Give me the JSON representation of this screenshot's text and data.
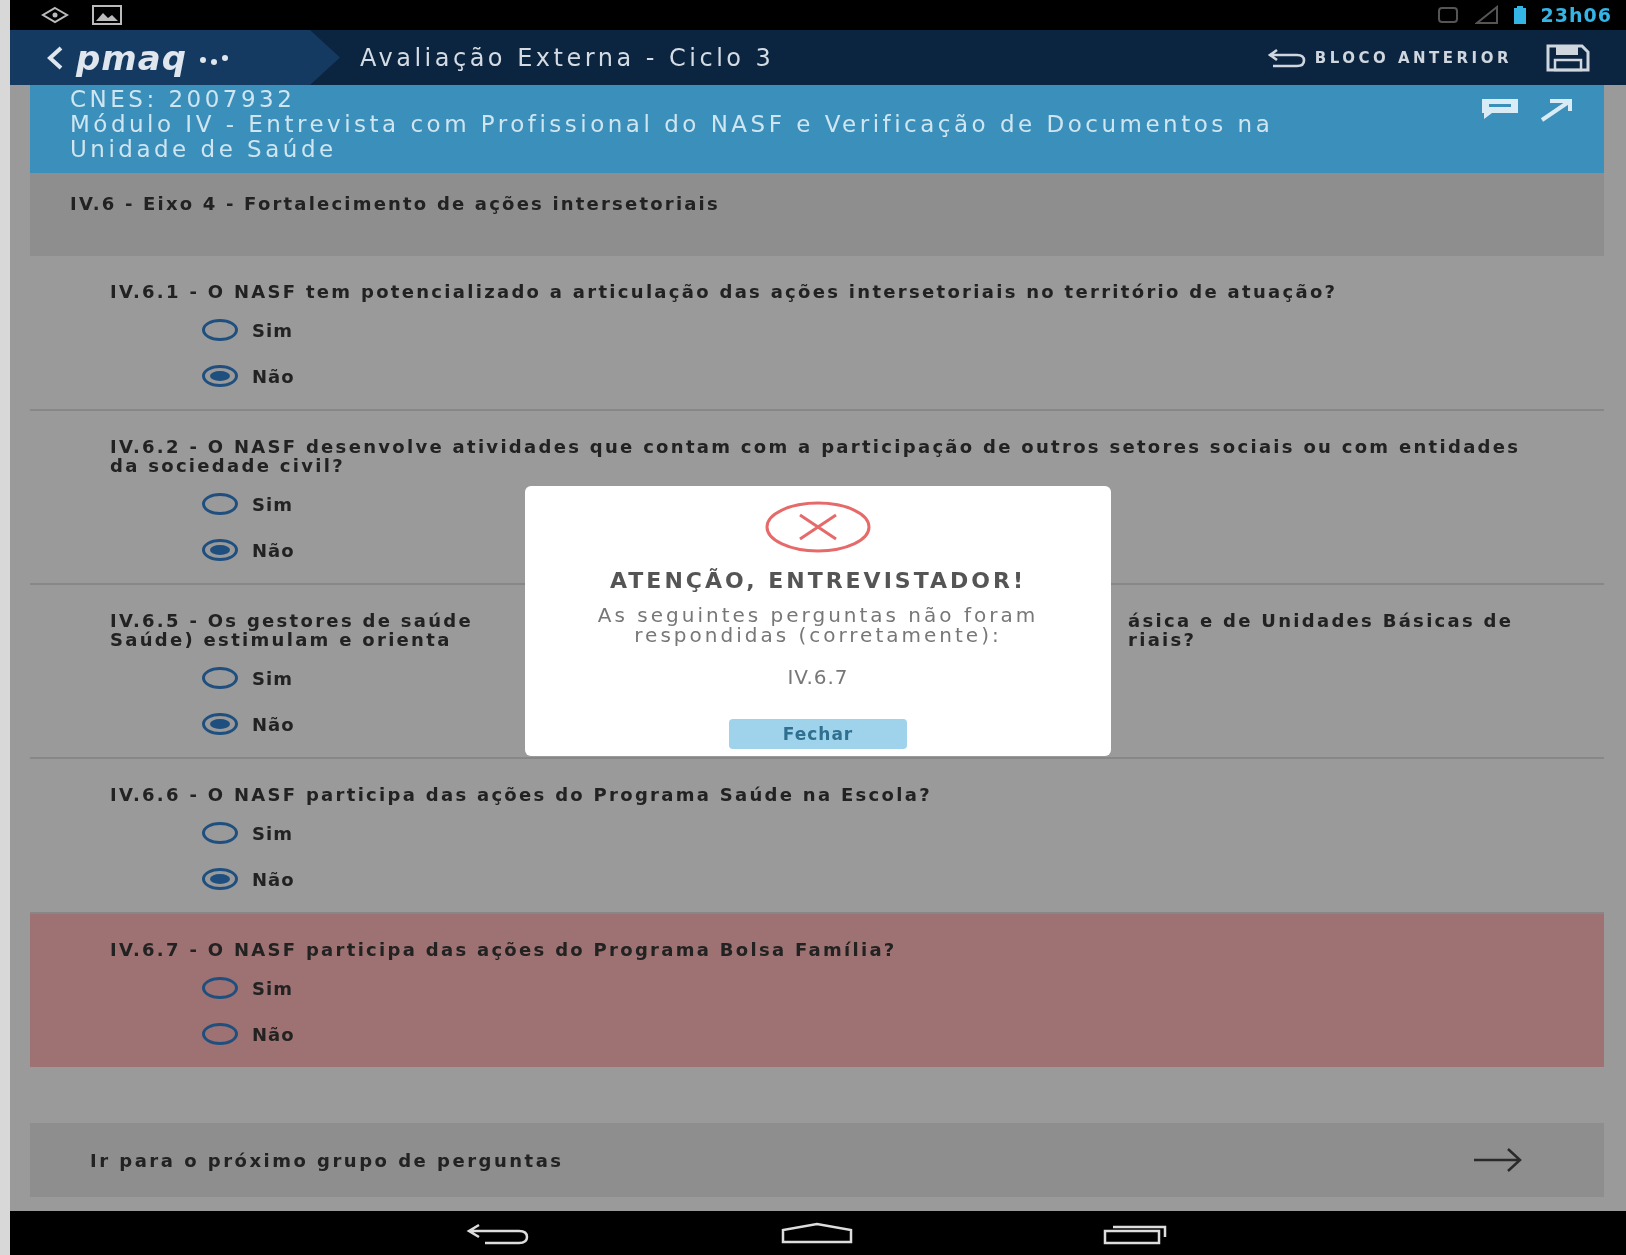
{
  "status_bar": {
    "time": "23h06"
  },
  "app_bar": {
    "logo": "pmaq",
    "title": "Avaliação Externa - Ciclo 3",
    "back_action": "BLOCO ANTERIOR"
  },
  "module": {
    "cnes": "CNES: 2007932",
    "title": "Módulo IV - Entrevista com Profissional do NASF e Verificação de Documentos na Unidade de Saúde"
  },
  "section": {
    "title": "IV.6 - Eixo 4 - Fortalecimento de ações intersetoriais"
  },
  "questions": [
    {
      "kind": "full",
      "error": false,
      "text": "IV.6.1 - O NASF tem potencializado a articulação das ações intersetoriais no território de atuação?",
      "options": [
        {
          "label": "Sim",
          "selected": false
        },
        {
          "label": "Não",
          "selected": true
        }
      ]
    },
    {
      "kind": "full",
      "error": false,
      "text": "IV.6.2 - O NASF desenvolve atividades que contam com a participação de outros setores sociais ou com entidades da sociedade civil?",
      "options": [
        {
          "label": "Sim",
          "selected": false
        },
        {
          "label": "Não",
          "selected": true
        }
      ]
    },
    {
      "kind": "split",
      "error": false,
      "left_lines": [
        "IV.6.5 - Os gestores de saúde",
        "Saúde) estimulam e orienta"
      ],
      "right_lines": [
        "ásica e de Unidades Básicas de",
        "riais?"
      ],
      "options": [
        {
          "label": "Sim",
          "selected": false
        },
        {
          "label": "Não",
          "selected": true
        }
      ]
    },
    {
      "kind": "full",
      "error": false,
      "text": "IV.6.6 - O NASF participa das ações do Programa Saúde na Escola?",
      "options": [
        {
          "label": "Sim",
          "selected": false
        },
        {
          "label": "Não",
          "selected": true
        }
      ]
    },
    {
      "kind": "full",
      "error": true,
      "text": "IV.6.7 - O NASF participa das ações do Programa Bolsa Família?",
      "options": [
        {
          "label": "Sim",
          "selected": false
        },
        {
          "label": "Não",
          "selected": false
        }
      ]
    }
  ],
  "next": {
    "label": "Ir para o próximo grupo de perguntas"
  },
  "dialog": {
    "title": "ATENÇÃO, ENTREVISTADOR!",
    "message": "As seguintes perguntas não foram respondidas (corretamente):",
    "items": [
      "IV.6.7"
    ],
    "button": {
      "label": "Fechar",
      "disabled": true
    }
  }
}
